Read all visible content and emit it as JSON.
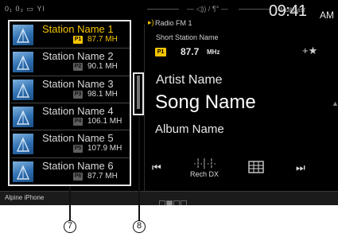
{
  "status": {
    "icons": "0₁ 0₂ ▭ Yl",
    "center": "— ◁)) / ¶° —",
    "multicast": "Multicast",
    "time": "09:41",
    "ampm": "AM"
  },
  "stations": [
    {
      "name": "Station Name 1",
      "preset": "P1",
      "freq": "87.7 MH",
      "active": true
    },
    {
      "name": "Station Name 2",
      "preset": "P2",
      "freq": "90.1 MH",
      "active": false
    },
    {
      "name": "Station Name 3",
      "preset": "P3",
      "freq": "98.1 MH",
      "active": false
    },
    {
      "name": "Station Name 4",
      "preset": "P4",
      "freq": "106.1 MH",
      "active": false
    },
    {
      "name": "Station Name 5",
      "preset": "P5",
      "freq": "107.9 MH",
      "active": false
    },
    {
      "name": "Station Name 6",
      "preset": "P6",
      "freq": "87.7 MH",
      "active": false
    }
  ],
  "now_playing": {
    "band": "Radio FM 1",
    "short_name": "Short Station Name",
    "preset": "P1",
    "freq": "87.7",
    "unit": "MHz",
    "favorite": "+★",
    "artist": "Artist Name",
    "song": "Song Name",
    "album": "Album Name"
  },
  "controls": {
    "prev": "⏮",
    "rech_icon": "·┆·│·┆·",
    "rech_label": "Rech DX",
    "next": "⏭"
  },
  "bottom": {
    "device": "Alpine iPhone"
  },
  "callouts": {
    "list": "7",
    "scroll": "8"
  },
  "colors": {
    "accent": "#f5c400",
    "background": "#000000",
    "text": "#e8e8e8"
  }
}
